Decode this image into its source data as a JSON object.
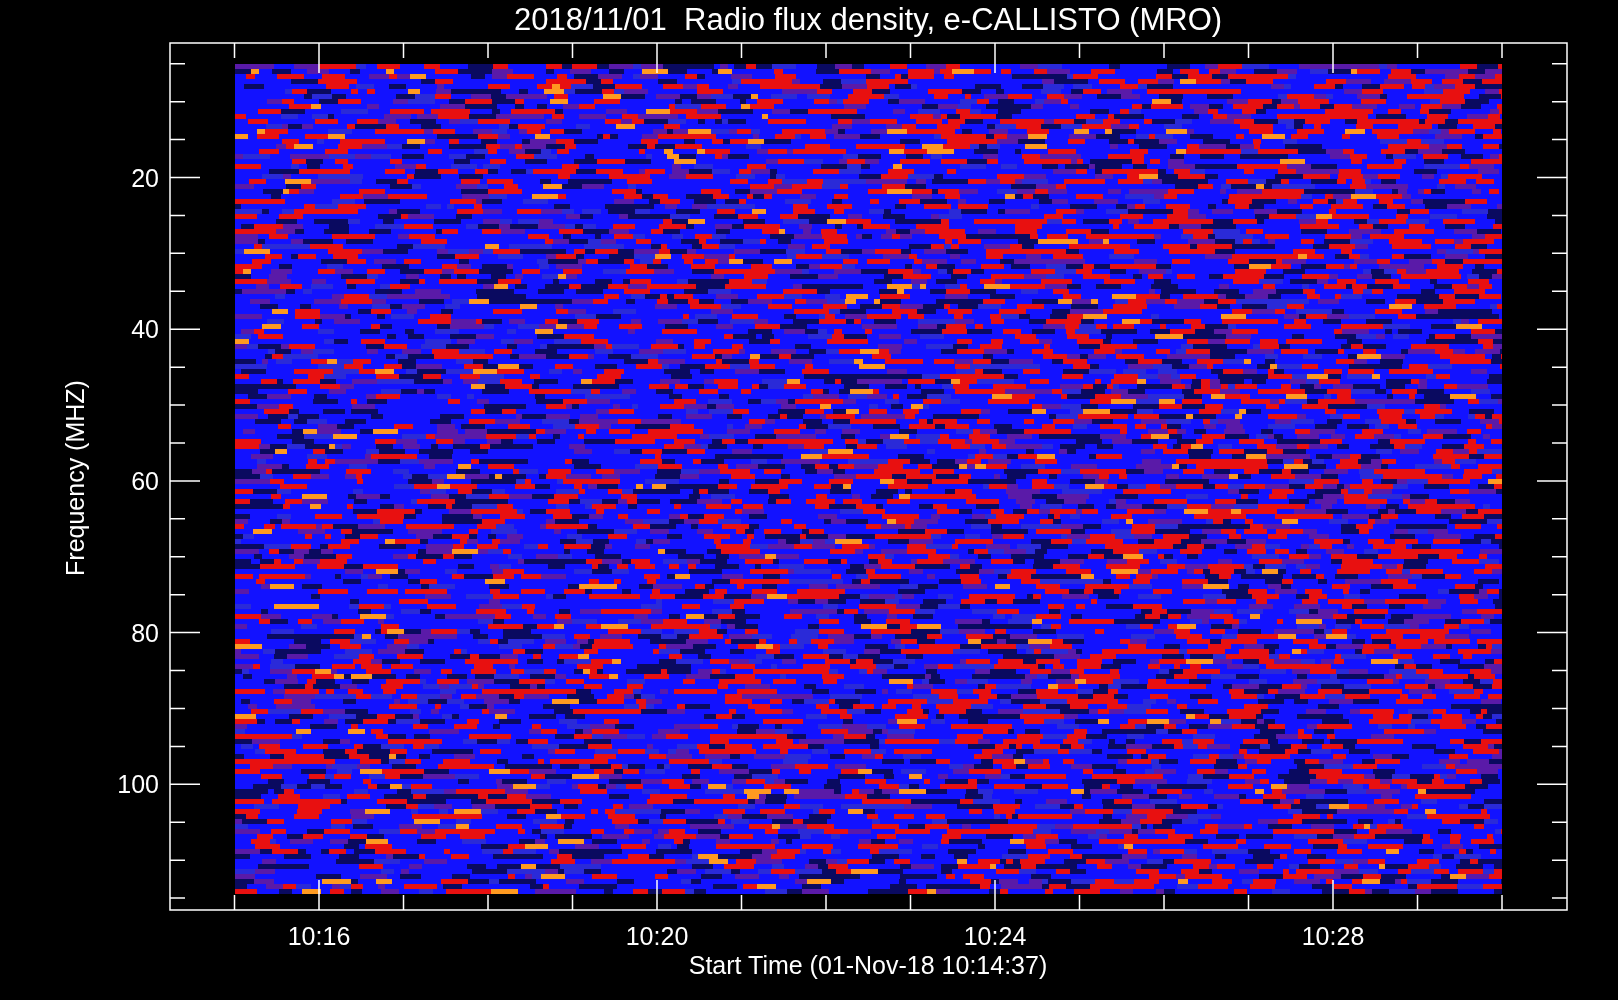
{
  "title": "2018/11/01  Radio flux density, e-CALLISTO (MRO)",
  "y_axis": {
    "label": "Frequency (MHZ)",
    "ticks": [
      "20",
      "40",
      "60",
      "80",
      "100"
    ]
  },
  "x_axis": {
    "label": "Start Time (01-Nov-18 10:14:37)",
    "ticks": [
      "10:16",
      "10:20",
      "10:24",
      "10:28"
    ]
  }
}
